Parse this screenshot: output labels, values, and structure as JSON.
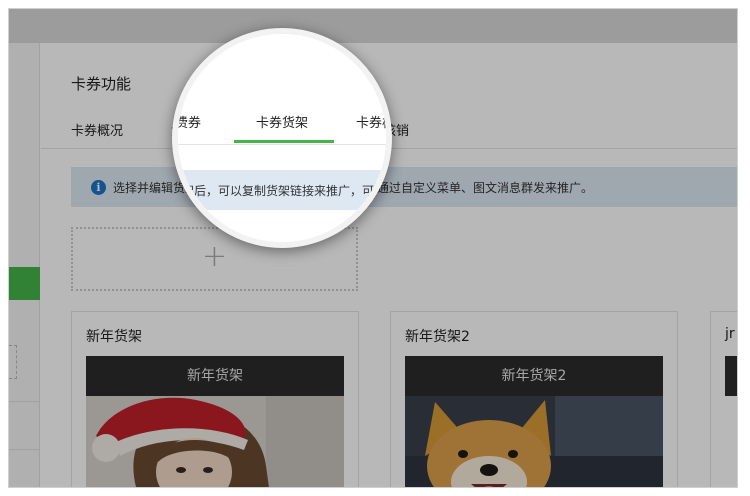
{
  "page": {
    "title": "卡券功能"
  },
  "tabs": [
    {
      "label": "卡券概况"
    },
    {
      "label": "免费券"
    },
    {
      "label": "卡券货架"
    },
    {
      "label": "卡券核销"
    }
  ],
  "notice": {
    "text": "选择并编辑货架后，可以复制货架链接来推广，可通过自定义菜单、图文消息群发来推广。"
  },
  "add_box": {
    "symbol": "+"
  },
  "cards": [
    {
      "name": "新年货架",
      "banner": "新年货架"
    },
    {
      "name": "新年货架2",
      "banner": "新年货架2"
    },
    {
      "name": "jr"
    }
  ],
  "colors": {
    "accent": "#44b549",
    "info": "#1a73c8",
    "notice_bg": "#dde8f3",
    "banner": "#2c2c2c"
  }
}
